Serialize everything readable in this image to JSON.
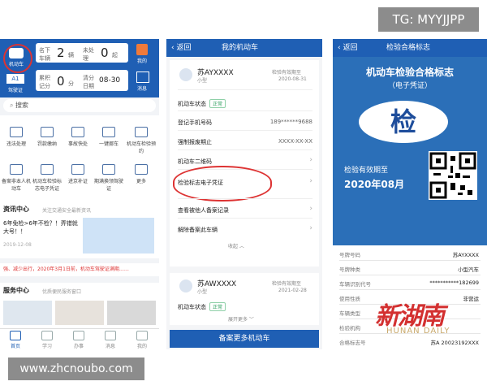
{
  "overlay": {
    "top_tag": "TG: MYYJJPP",
    "bottom_watermark": "www.zhcnoubo.com"
  },
  "phone1": {
    "header": {
      "profile_label": "机动车",
      "vehicle_label": "名下车辆",
      "vehicle_count": "2",
      "vehicle_unit": "辆",
      "unprocessed_label": "未处理",
      "unprocessed_count": "0",
      "unprocessed_unit": "起",
      "mine_label": "我的",
      "license_label": "驾驶证",
      "license_class": "A1",
      "points_label": "累积记分",
      "points_value": "0",
      "points_unit": "分",
      "cycle_label": "清分日期",
      "cycle_date": "08-30",
      "msg_label": "消息"
    },
    "search_placeholder": "搜索",
    "grid": [
      {
        "label": "违法处理"
      },
      {
        "label": "罚款缴纳"
      },
      {
        "label": "事故快处"
      },
      {
        "label": "一键挪车"
      },
      {
        "label": "机动车检验预约"
      },
      {
        "label": "备案非本人机动车"
      },
      {
        "label": "机动车检验标志电子凭证"
      },
      {
        "label": "进京补证"
      },
      {
        "label": "期满换领驾驶证"
      },
      {
        "label": "更多"
      }
    ],
    "news_title": "资讯中心",
    "news_sub": "关注交通安全最新资讯",
    "news_headline": "6年免检>6年不检？！弄错就大号！！",
    "news_date": "2019-12-08",
    "notice": "强、减少出行，2020年3月1日前，机动车驾驶证满期……",
    "service_title": "服务中心",
    "service_sub": "优质便民服务窗口",
    "tabs": [
      "首页",
      "学习",
      "办事",
      "消息",
      "我的"
    ]
  },
  "phone2": {
    "back": "返回",
    "title": "我的机动车",
    "car1": {
      "plate": "苏AYXXXX",
      "type": "小型",
      "expiry_label": "检验有效期至",
      "expiry": "2020-08-31"
    },
    "rows": [
      {
        "label": "机动车状态",
        "value": "正常"
      },
      {
        "label": "登记手机号码",
        "value": "189******9688"
      },
      {
        "label": "强制报废期止",
        "value": "XXXX-XX-XX"
      },
      {
        "label": "机动车二维码",
        "value": ""
      },
      {
        "label": "检验标志电子凭证",
        "value": ""
      },
      {
        "label": "查看被他人备案记录",
        "value": ""
      },
      {
        "label": "解除备案此车辆",
        "value": ""
      }
    ],
    "collapse": "收起",
    "car2": {
      "plate": "苏AWXXXX",
      "type": "小型",
      "expiry_label": "检验有效期至",
      "expiry": "2021-02-28",
      "status_label": "机动车状态",
      "status": "正常"
    },
    "more": "展开更多",
    "bottom_button": "备案更多机动车"
  },
  "phone3": {
    "back": "返回",
    "title": "检验合格标志",
    "cert_title": "机动车检验合格标志",
    "cert_sub": "（电子凭证）",
    "emblem": "检",
    "valid_label": "检验有效期至",
    "valid_date": "2020年08月",
    "rows": [
      {
        "label": "号牌号码",
        "value": "苏AYXXXX"
      },
      {
        "label": "号牌种类",
        "value": "小型汽车"
      },
      {
        "label": "车辆识别代号",
        "value": "***********182699"
      },
      {
        "label": "使用性质",
        "value": "非营运"
      },
      {
        "label": "车辆类型",
        "value": ""
      },
      {
        "label": "检验机构",
        "value": ""
      },
      {
        "label": "合格标志号",
        "value": "苏A 20023192XXX"
      }
    ],
    "stamp": "新湖南",
    "stamp_sub": "HUNAN DAILY"
  }
}
